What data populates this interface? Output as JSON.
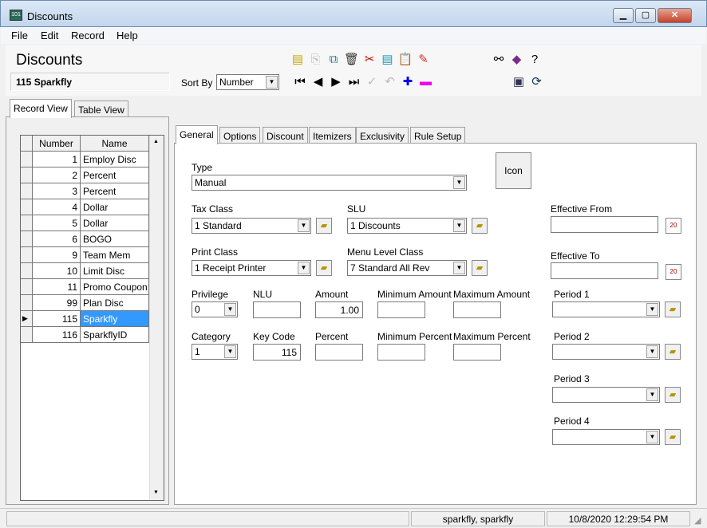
{
  "window": {
    "title": "Discounts",
    "minimize": "▁",
    "maximize": "▢",
    "close": "✕"
  },
  "menu": [
    "File",
    "Edit",
    "Record",
    "Help"
  ],
  "header": {
    "title": "Discounts",
    "record": "115 Sparkfly",
    "sort_by_label": "Sort By",
    "sort_by_value": "Number"
  },
  "toolbar": {
    "row1": [
      "new-record-icon",
      "copy-record-icon",
      "merge-record-icon",
      "delete-icon",
      "cut-icon",
      "paste-record-icon",
      "clipboard-icon",
      "eraser-icon"
    ],
    "row1_right": [
      "find-binoculars-icon",
      "help-book-icon",
      "whats-this-help-icon"
    ],
    "row2": [
      "first-record-icon",
      "previous-record-icon",
      "next-record-icon",
      "last-record-icon",
      "save-check-icon",
      "undo-icon",
      "add-icon",
      "remove-icon"
    ],
    "row2_right": [
      "terminal-icon",
      "refresh-sync-icon"
    ]
  },
  "view_tabs": [
    "Record View",
    "Table View"
  ],
  "grid": {
    "columns": [
      "Number",
      "Name"
    ],
    "rows": [
      {
        "number": "1",
        "name": "Employ Disc"
      },
      {
        "number": "2",
        "name": "Percent"
      },
      {
        "number": "3",
        "name": "Percent"
      },
      {
        "number": "4",
        "name": "Dollar"
      },
      {
        "number": "5",
        "name": "Dollar"
      },
      {
        "number": "6",
        "name": "BOGO"
      },
      {
        "number": "9",
        "name": "Team Mem"
      },
      {
        "number": "10",
        "name": "Limit Disc"
      },
      {
        "number": "11",
        "name": "Promo Coupon"
      },
      {
        "number": "99",
        "name": "Plan Disc"
      },
      {
        "number": "115",
        "name": "Sparkfly",
        "selected": true
      },
      {
        "number": "116",
        "name": "SparkflyID"
      }
    ],
    "selection_color": "#3399ff"
  },
  "detail_tabs": [
    "General",
    "Options",
    "Discount",
    "Itemizers",
    "Exclusivity",
    "Rule Setup"
  ],
  "form": {
    "icon_button": "Icon",
    "type": {
      "label": "Type",
      "value": "Manual"
    },
    "tax_class": {
      "label": "Tax Class",
      "value": "1  Standard"
    },
    "slu": {
      "label": "SLU",
      "value": "1  Discounts"
    },
    "print_class": {
      "label": "Print Class",
      "value": "1  Receipt Printer"
    },
    "menu_level_class": {
      "label": "Menu Level Class",
      "value": "7  Standard All Rev"
    },
    "effective_from": {
      "label": "Effective From",
      "value": ""
    },
    "effective_to": {
      "label": "Effective To",
      "value": ""
    },
    "privilege": {
      "label": "Privilege",
      "value": "0"
    },
    "nlu": {
      "label": "NLU",
      "value": ""
    },
    "amount": {
      "label": "Amount",
      "value": "1.00"
    },
    "minimum_amount": {
      "label": "Minimum Amount",
      "value": ""
    },
    "maximum_amount": {
      "label": "Maximum Amount",
      "value": ""
    },
    "category": {
      "label": "Category",
      "value": "1"
    },
    "key_code": {
      "label": "Key Code",
      "value": "115"
    },
    "percent": {
      "label": "Percent",
      "value": ""
    },
    "minimum_percent": {
      "label": "Minimum Percent",
      "value": ""
    },
    "maximum_percent": {
      "label": "Maximum Percent",
      "value": ""
    },
    "period_1": {
      "label": "Period 1",
      "value": ""
    },
    "period_2": {
      "label": "Period 2",
      "value": ""
    },
    "period_3": {
      "label": "Period 3",
      "value": ""
    },
    "period_4": {
      "label": "Period 4",
      "value": ""
    }
  },
  "status": {
    "user": "sparkfly, sparkfly",
    "datetime": "10/8/2020 12:29:54 PM"
  }
}
